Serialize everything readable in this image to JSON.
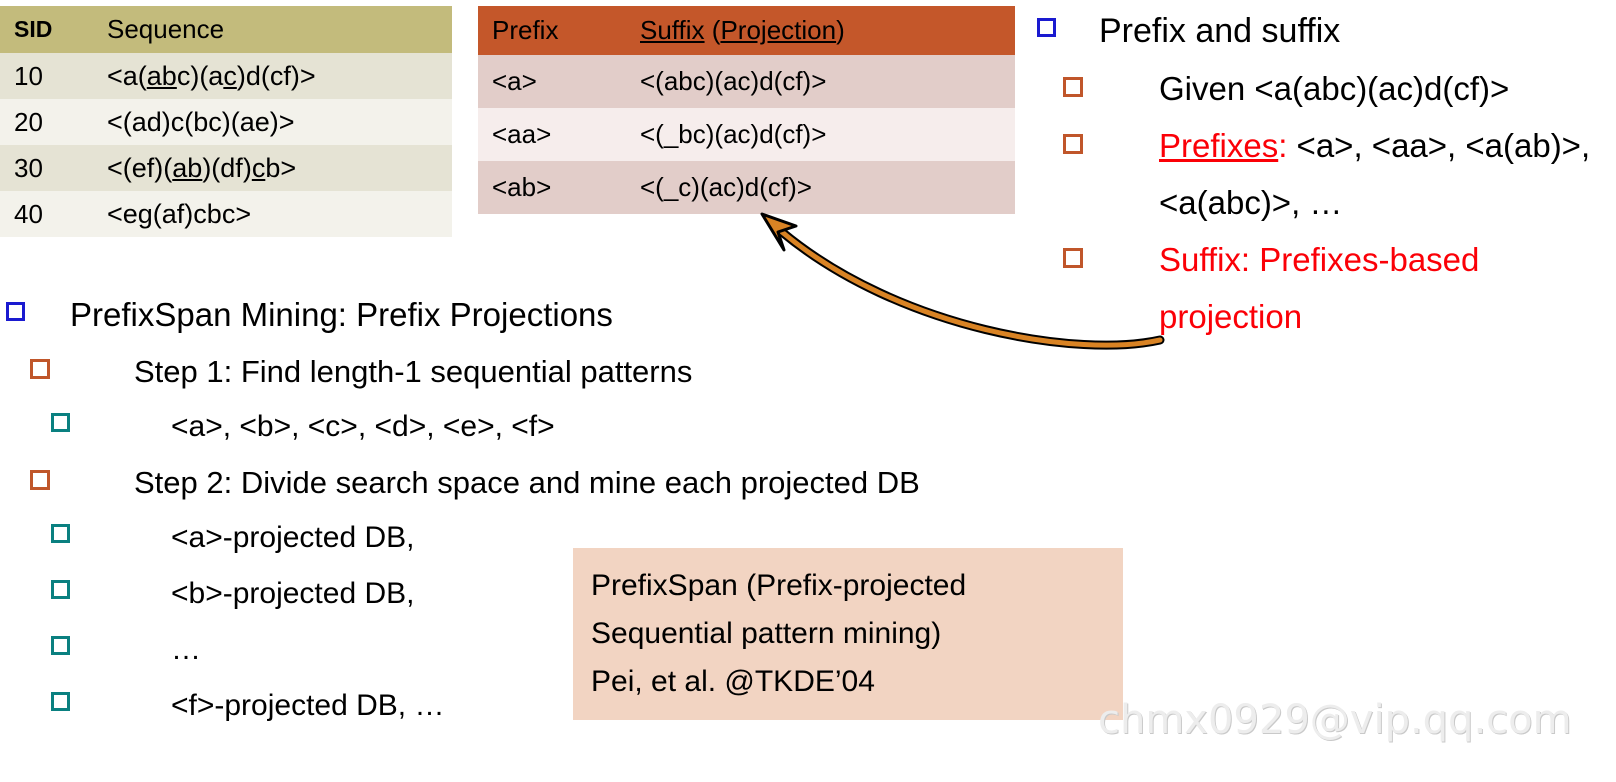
{
  "sequence_table": {
    "headers": [
      "SID",
      "Sequence"
    ],
    "rows": [
      {
        "sid": "10",
        "seq_pre": "<a(",
        "seq_u1": "ab",
        "seq_mid": "c)(a",
        "seq_u2": "c",
        "seq_post": ")d(cf)>",
        "full": "<a(abc)(ac)d(cf)>"
      },
      {
        "sid": "20",
        "seq_pre": "<(ad)c(bc)(ae)>",
        "seq_u1": "",
        "seq_mid": "",
        "seq_u2": "",
        "seq_post": "",
        "full": "<(ad)c(bc)(ae)>"
      },
      {
        "sid": "30",
        "seq_pre": "<(ef)(",
        "seq_u1": "ab",
        "seq_mid": ")(df)",
        "seq_u2": "c",
        "seq_post": "b>",
        "full": "<(ef)(ab)(df)cb>"
      },
      {
        "sid": "40",
        "seq_pre": "<eg(af)cbc>",
        "seq_u1": "",
        "seq_mid": "",
        "seq_u2": "",
        "seq_post": "",
        "full": "<eg(af)cbc>"
      }
    ]
  },
  "projection_table": {
    "header_prefix": "Prefix",
    "header_suffix_u": "Suffix",
    "header_suffix_rest_open": " (",
    "header_suffix_rest_u": "Projection",
    "header_suffix_rest_close": ")",
    "rows": [
      {
        "prefix": "<a>",
        "suffix": "<(abc)(ac)d(cf)>"
      },
      {
        "prefix": "<aa>",
        "suffix": "<(_bc)(ac)d(cf)>"
      },
      {
        "prefix": "<ab>",
        "suffix": "<(_c)(ac)d(cf)>"
      }
    ]
  },
  "outline": {
    "title": "PrefixSpan Mining: Prefix Projections",
    "step1": "Step 1: Find length-1 sequential patterns",
    "step1_items": "<a>, <b>, <c>, <d>, <e>, <f>",
    "step2": "Step 2: Divide search space and mine each projected DB",
    "step2_items": [
      "<a>-projected DB,",
      "<b>-projected DB,",
      "…",
      "<f>-projected DB, …"
    ]
  },
  "right_panel": {
    "heading": "Prefix and suffix",
    "given": "Given <a(abc)(ac)d(cf)>",
    "prefixes_label": "Prefixes",
    "prefixes_colon": ":",
    "prefixes_value": " <a>, <aa>, <a(ab)>, <a(abc)>, …",
    "suffix_line": "Suffix: Prefixes-based projection"
  },
  "citation": {
    "line1": "PrefixSpan (Prefix-projected",
    "line2": "Sequential pattern mining)",
    "line3": "Pei, et al. @TKDE’04"
  },
  "watermark": "chmx0929@vip.qq.com",
  "colors": {
    "seq_header": "#c3bb7c",
    "seq_row_odd": "#e5e3d4",
    "seq_row_even": "#f3f2eb",
    "proj_header": "#c4572a",
    "proj_row_odd": "#e2cdc9",
    "proj_row_even": "#f6edec",
    "bullet_blue": "#1a1ad0",
    "bullet_orange": "#c0562a",
    "bullet_teal": "#0a8080",
    "accent_red": "#fb0007",
    "citation_bg": "#f2d4c2",
    "arrow": "#d98324"
  }
}
